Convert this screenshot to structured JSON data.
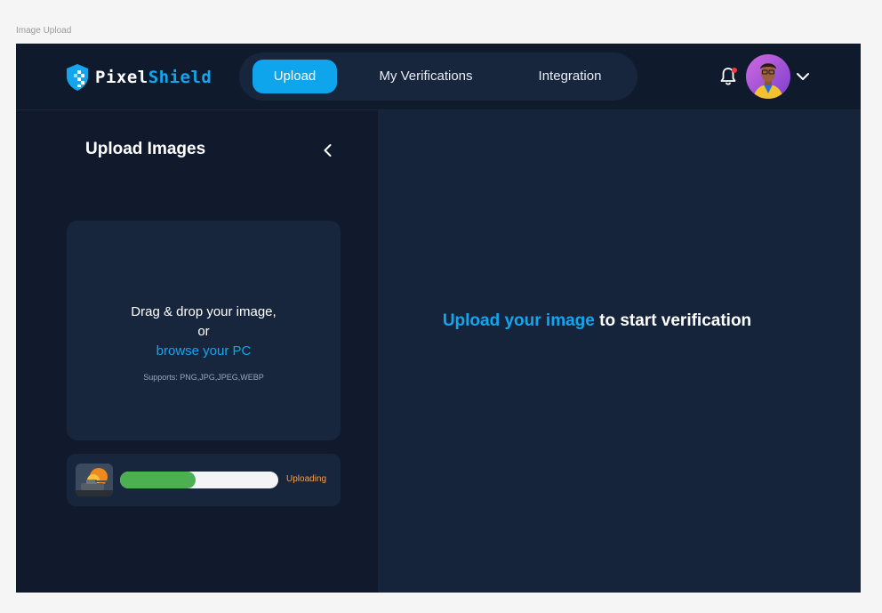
{
  "frame": {
    "label": "Image Upload"
  },
  "brand": {
    "name_part1": "Pixel",
    "name_part2": "Shield",
    "accent": "#13a6ee"
  },
  "nav": {
    "items": [
      {
        "label": "Upload",
        "active": true
      },
      {
        "label": "My Verifications",
        "active": false
      },
      {
        "label": "Integration",
        "active": false
      }
    ]
  },
  "header": {
    "icons": [
      "bell-icon",
      "avatar",
      "chevron-down-icon"
    ],
    "notification_dot": true
  },
  "upload_panel": {
    "title": "Upload Images",
    "dropzone": {
      "line1": "Drag & drop your image,",
      "line2": "or",
      "browse_link": "browse your PC",
      "supports": "Supports: PNG,JPG,JPEG,WEBP"
    },
    "upload_item": {
      "status": "Uploading",
      "progress": 0.48,
      "progress_color": "#4caf50",
      "status_color": "#f5a04d"
    }
  },
  "main": {
    "cta_highlight": "Upload your image",
    "cta_rest": " to start verification"
  }
}
